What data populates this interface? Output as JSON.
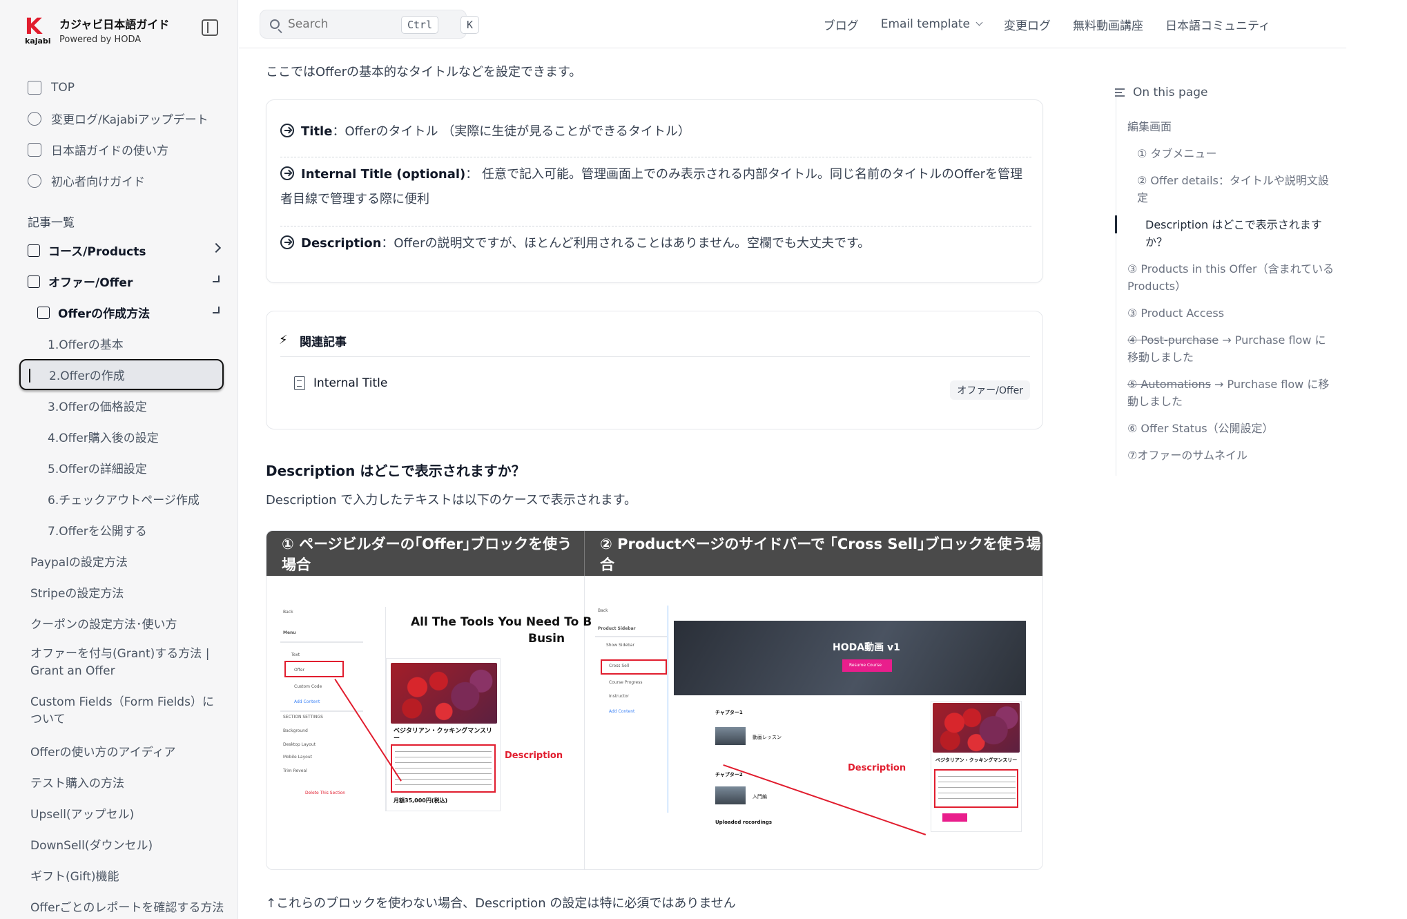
{
  "brand": {
    "logo_letter": "K",
    "logo_word": "kajabi",
    "title": "カジャビ日本語ガイド",
    "subtitle": "Powered by HODA",
    "accent": "#e11d2e"
  },
  "header": {
    "search_placeholder": "Search",
    "kbd_ctrl": "Ctrl",
    "kbd_k": "K",
    "nav": [
      "ブログ",
      "Email template",
      "変更ログ",
      "無料動画講座",
      "日本語コミュニティ"
    ]
  },
  "sidebar": {
    "top_items": [
      {
        "label": "TOP",
        "icon": "home-icon"
      },
      {
        "label": "変更ログ/Kajabiアップデート",
        "icon": "history-icon"
      },
      {
        "label": "日本語ガイドの使い方",
        "icon": "image-icon"
      },
      {
        "label": "初心者向けガイド",
        "icon": "smile-icon"
      }
    ],
    "section_title": "記事一覧",
    "tree": {
      "courses": "コース/Products",
      "offer": "オファー/Offer",
      "offer_create": "Offerの作成方法",
      "sub": [
        "1.Offerの基本",
        "2.Offerの作成",
        "3.Offerの価格設定",
        "4.Offer購入後の設定",
        "5.Offerの詳細設定",
        "6.チェックアウトページ作成",
        "7.Offerを公開する"
      ],
      "others": [
        "Paypalの設定方法",
        "Stripeの設定方法",
        "クーポンの設定方法･使い方",
        "オファーを付与(Grant)する方法 | Grant an Offer",
        "Custom Fields（Form Fields）について",
        "Offerの使い方のアイディア",
        "テスト購入の方法",
        "Upsell(アップセル)",
        "DownSell(ダウンセル)",
        "ギフト(Gift)機能",
        "Offerごとのレポートを確認する方法"
      ]
    }
  },
  "main": {
    "intro": "ここではOfferの基本的なタイトルなどを設定できます。",
    "defs": [
      {
        "term": "Title",
        "sep": "：",
        "text": "Offerのタイトル （実際に生徒が見ることができるタイトル）"
      },
      {
        "term": "Internal Title (optional)",
        "sep": "： ",
        "text": "任意で記入可能。管理画面上でのみ表示される内部タイトル。同じ名前のタイトルのOfferを管理者目線で管理する際に便利"
      },
      {
        "term": "Description",
        "sep": "：",
        "text": "Offerの説明文ですが、ほとんど利用されることはありません。空欄でも大丈夫です。"
      }
    ],
    "related": {
      "title": "関連記事",
      "link": "Internal Title",
      "tag": "オファー/Offer"
    },
    "h3": "Description はどこで表示されますか？",
    "p2": "Description で入力したテキストは以下のケースで表示されます。",
    "table": {
      "col1": "① ページビルダーの｢Offer｣ブロックを使う場合",
      "col2": "② Productページのサイドバーで ｢Cross Sell｣ブロックを使う場合"
    },
    "shot1": {
      "title_line1": "All The Tools You Need To B",
      "title_line2": "Busin",
      "product": "ベジタリアン・クッキングマンスリー",
      "price": "月額35,000円(税込)",
      "desc_label": "Description",
      "side_items": [
        "Back",
        "Menu",
        "Text",
        "Offer",
        "Custom Code",
        "Add Content",
        "SECTION SETTINGS",
        "Background",
        "Desktop Layout",
        "Mobile Layout",
        "Trim Reveal",
        "Delete This Section"
      ]
    },
    "shot2": {
      "hero_title": "HODA動画 v1",
      "hero_button": "Resume Course",
      "ch1": "チャプター1",
      "ch1_lesson": "動画レッスン",
      "ch2": "チャプター2",
      "ch2_lesson": "入門編",
      "uploaded": "Uploaded recordings",
      "product": "ベジタリアン・クッキングマンスリー",
      "desc_label": "Description",
      "side_items": [
        "Back",
        "Product Sidebar",
        "Show Sidebar",
        "Cross Sell",
        "Course Progress",
        "Instructor",
        "Add Content"
      ]
    },
    "note": "↑これらのブロックを使わない場合、Description の設定は特に必須ではありません"
  },
  "toc": {
    "title": "On this page",
    "items": [
      {
        "label": "編集画面",
        "level": 1
      },
      {
        "label": "① タブメニュー",
        "level": 2
      },
      {
        "label": "② Offer details：タイトルや説明文設定",
        "level": 2
      },
      {
        "label": "Description はどこで表示されますか？",
        "level": 3
      },
      {
        "label": "③ Products in this Offer（含まれているProducts）",
        "level": 1
      },
      {
        "label": "③ Product Access",
        "level": 1
      },
      {
        "label_strike": "④ Post-purchase",
        "label_rest": " → Purchase flow に移動しました",
        "level": 1
      },
      {
        "label_strike": "⑤ Automations",
        "label_rest": " → Purchase flow に移動しました",
        "level": 1
      },
      {
        "label": "⑥ Offer Status（公開設定）",
        "level": 1
      },
      {
        "label": "⑦オファーのサムネイル",
        "level": 1
      }
    ]
  }
}
